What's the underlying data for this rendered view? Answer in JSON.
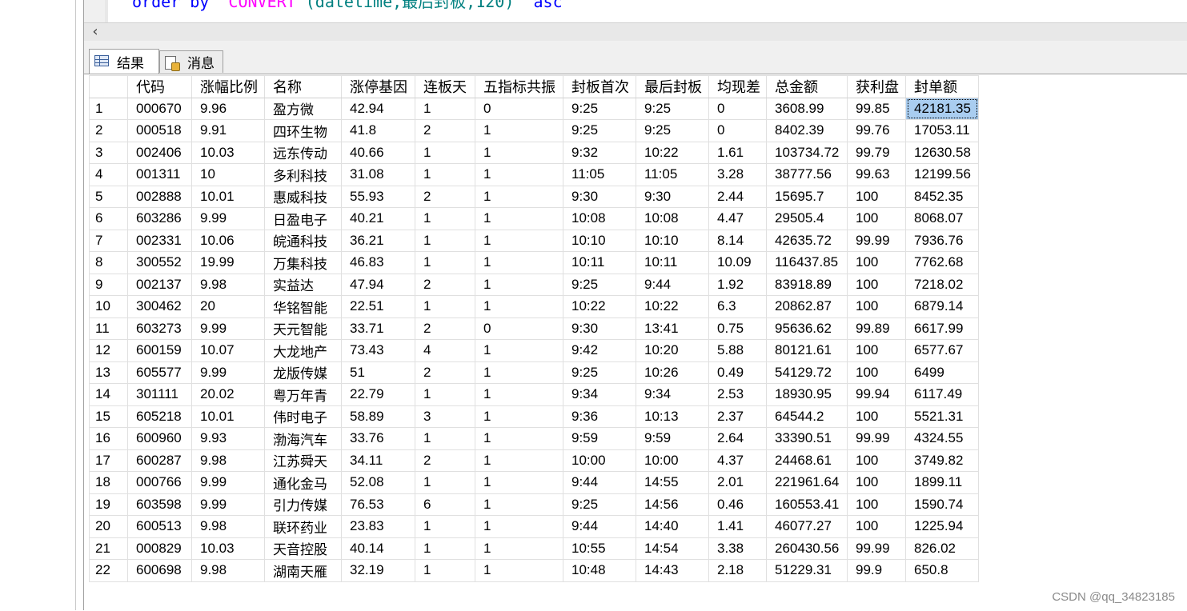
{
  "editor": {
    "code_keyword": "order by",
    "code_fn": "CONVERT",
    "code_args": "(datetime,最后封板,120)",
    "code_dir": "asc"
  },
  "tabs": {
    "results_label": "结果",
    "messages_label": "消息"
  },
  "grid": {
    "columns": [
      "代码",
      "涨幅比例",
      "名称",
      "涨停基因",
      "连板天",
      "五指标共振",
      "封板首次",
      "最后封板",
      "均现差",
      "总金额",
      "获利盘",
      "封单额"
    ],
    "rows": [
      [
        "1",
        "000670",
        "9.96",
        "盈方微",
        "42.94",
        "1",
        "0",
        "9:25",
        "9:25",
        "0",
        "3608.99",
        "99.85",
        "42181.35"
      ],
      [
        "2",
        "000518",
        "9.91",
        "四环生物",
        "41.8",
        "2",
        "1",
        "9:25",
        "9:25",
        "0",
        "8402.39",
        "99.76",
        "17053.11"
      ],
      [
        "3",
        "002406",
        "10.03",
        "远东传动",
        "40.66",
        "1",
        "1",
        "9:32",
        "10:22",
        "1.61",
        "103734.72",
        "99.79",
        "12630.58"
      ],
      [
        "4",
        "001311",
        "10",
        "多利科技",
        "31.08",
        "1",
        "1",
        "11:05",
        "11:05",
        "3.28",
        "38777.56",
        "99.63",
        "12199.56"
      ],
      [
        "5",
        "002888",
        "10.01",
        "惠威科技",
        "55.93",
        "2",
        "1",
        "9:30",
        "9:30",
        "2.44",
        "15695.7",
        "100",
        "8452.35"
      ],
      [
        "6",
        "603286",
        "9.99",
        "日盈电子",
        "40.21",
        "1",
        "1",
        "10:08",
        "10:08",
        "4.47",
        "29505.4",
        "100",
        "8068.07"
      ],
      [
        "7",
        "002331",
        "10.06",
        "皖通科技",
        "36.21",
        "1",
        "1",
        "10:10",
        "10:10",
        "8.14",
        "42635.72",
        "99.99",
        "7936.76"
      ],
      [
        "8",
        "300552",
        "19.99",
        "万集科技",
        "46.83",
        "1",
        "1",
        "10:11",
        "10:11",
        "10.09",
        "116437.85",
        "100",
        "7762.68"
      ],
      [
        "9",
        "002137",
        "9.98",
        "实益达",
        "47.94",
        "2",
        "1",
        "9:25",
        "9:44",
        "1.92",
        "83918.89",
        "100",
        "7218.02"
      ],
      [
        "10",
        "300462",
        "20",
        "华铭智能",
        "22.51",
        "1",
        "1",
        "10:22",
        "10:22",
        "6.3",
        "20862.87",
        "100",
        "6879.14"
      ],
      [
        "11",
        "603273",
        "9.99",
        "天元智能",
        "33.71",
        "2",
        "0",
        "9:30",
        "13:41",
        "0.75",
        "95636.62",
        "99.89",
        "6617.99"
      ],
      [
        "12",
        "600159",
        "10.07",
        "大龙地产",
        "73.43",
        "4",
        "1",
        "9:42",
        "10:20",
        "5.88",
        "80121.61",
        "100",
        "6577.67"
      ],
      [
        "13",
        "605577",
        "9.99",
        "龙版传媒",
        "51",
        "2",
        "1",
        "9:25",
        "10:26",
        "0.49",
        "54129.72",
        "100",
        "6499"
      ],
      [
        "14",
        "301111",
        "20.02",
        "粤万年青",
        "22.79",
        "1",
        "1",
        "9:34",
        "9:34",
        "2.53",
        "18930.95",
        "99.94",
        "6117.49"
      ],
      [
        "15",
        "605218",
        "10.01",
        "伟时电子",
        "58.89",
        "3",
        "1",
        "9:36",
        "10:13",
        "2.37",
        "64544.2",
        "100",
        "5521.31"
      ],
      [
        "16",
        "600960",
        "9.93",
        "渤海汽车",
        "33.76",
        "1",
        "1",
        "9:59",
        "9:59",
        "2.64",
        "33390.51",
        "99.99",
        "4324.55"
      ],
      [
        "17",
        "600287",
        "9.98",
        "江苏舜天",
        "34.11",
        "2",
        "1",
        "10:00",
        "10:00",
        "4.37",
        "24468.61",
        "100",
        "3749.82"
      ],
      [
        "18",
        "000766",
        "9.99",
        "通化金马",
        "52.08",
        "1",
        "1",
        "9:44",
        "14:55",
        "2.01",
        "221961.64",
        "100",
        "1899.11"
      ],
      [
        "19",
        "603598",
        "9.99",
        "引力传媒",
        "76.53",
        "6",
        "1",
        "9:25",
        "14:56",
        "0.46",
        "160553.41",
        "100",
        "1590.74"
      ],
      [
        "20",
        "600513",
        "9.98",
        "联环药业",
        "23.83",
        "1",
        "1",
        "9:44",
        "14:40",
        "1.41",
        "46077.27",
        "100",
        "1225.94"
      ],
      [
        "21",
        "000829",
        "10.03",
        "天音控股",
        "40.14",
        "1",
        "1",
        "10:55",
        "14:54",
        "3.38",
        "260430.56",
        "99.99",
        "826.02"
      ],
      [
        "22",
        "600698",
        "9.98",
        "湖南天雁",
        "32.19",
        "1",
        "1",
        "10:48",
        "14:43",
        "2.18",
        "51229.31",
        "99.9",
        "650.8"
      ]
    ],
    "selected_cell": {
      "row": 0,
      "col": 12
    }
  },
  "icons": {
    "results_tab": "grid-icon",
    "messages_tab": "message-icon",
    "scroll_left": "chevron-left-icon"
  },
  "scroll_left_glyph": "‹",
  "watermark": "CSDN @qq_34823185"
}
